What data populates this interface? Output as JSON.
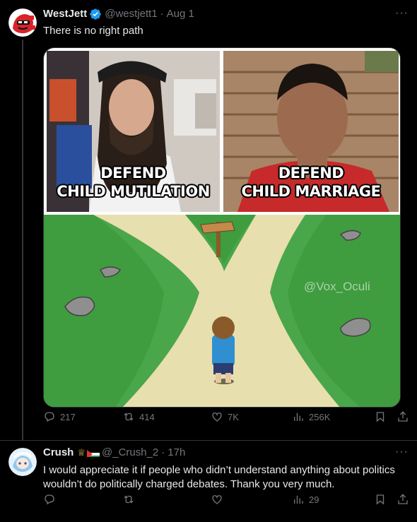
{
  "tweets": [
    {
      "author_name": "WestJett",
      "handle": "@westjett1",
      "time": "Aug 1",
      "text": "There is no right path",
      "image": {
        "left_caption_line1": "DEFEND",
        "left_caption_line2": "CHILD MUTILATION",
        "right_caption_line1": "DEFEND",
        "right_caption_line2": "CHILD MARRIAGE",
        "watermark": "@Vox_Oculi"
      },
      "replies": "217",
      "reposts": "414",
      "likes": "7K",
      "views": "256K"
    },
    {
      "author_name": "Crush",
      "handle": "@_Crush_2",
      "time": "17h",
      "text": "I would appreciate it if people who didn’t understand anything about politics wouldn’t do politically charged debates. Thank you very much.",
      "replies": "",
      "reposts": "",
      "likes": "",
      "views": "29"
    }
  ],
  "colors": {
    "background": "#000000",
    "text_primary": "#e7e9ea",
    "text_secondary": "#71767b",
    "verified": "#1d9bf0",
    "divider": "#2f3336"
  },
  "icons": [
    "verified-badge-icon",
    "more-icon",
    "reply-icon",
    "repost-icon",
    "like-icon",
    "views-icon",
    "bookmark-icon",
    "share-icon",
    "crown-icon",
    "flag-icon"
  ]
}
